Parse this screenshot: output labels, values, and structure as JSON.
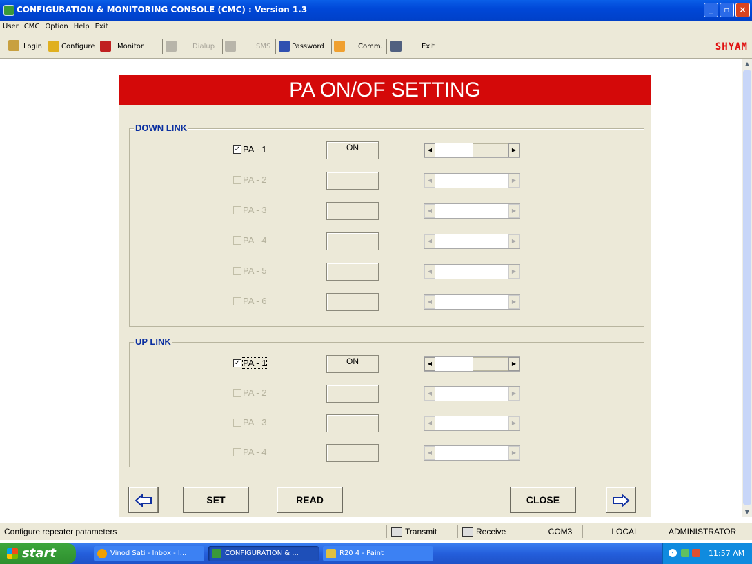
{
  "window": {
    "title": "CONFIGURATION & MONITORING CONSOLE (CMC) : Version 1.3",
    "brand": "SHYAM"
  },
  "menu": [
    "User",
    "CMC",
    "Option",
    "Help",
    "Exit"
  ],
  "toolbar": {
    "login": "Login",
    "configure": "Configure",
    "monitor": "Monitor",
    "dialup": "Dialup",
    "sms": "SMS",
    "password": "Password",
    "comm": "Comm.",
    "exit": "Exit"
  },
  "form": {
    "title": "PA ON/OF SETTING",
    "downlink": {
      "label": "DOWN LINK",
      "rows": [
        {
          "label": "PA - 1",
          "checked": true,
          "enabled": true,
          "status": "ON"
        },
        {
          "label": "PA - 2",
          "checked": false,
          "enabled": false,
          "status": ""
        },
        {
          "label": "PA - 3",
          "checked": false,
          "enabled": false,
          "status": ""
        },
        {
          "label": "PA - 4",
          "checked": false,
          "enabled": false,
          "status": ""
        },
        {
          "label": "PA - 5",
          "checked": false,
          "enabled": false,
          "status": ""
        },
        {
          "label": "PA - 6",
          "checked": false,
          "enabled": false,
          "status": ""
        }
      ]
    },
    "uplink": {
      "label": "UP LINK",
      "rows": [
        {
          "label": "PA - 1",
          "checked": true,
          "enabled": true,
          "status": "ON"
        },
        {
          "label": "PA - 2",
          "checked": false,
          "enabled": false,
          "status": ""
        },
        {
          "label": "PA - 3",
          "checked": false,
          "enabled": false,
          "status": ""
        },
        {
          "label": "PA - 4",
          "checked": false,
          "enabled": false,
          "status": ""
        }
      ]
    },
    "buttons": {
      "set": "SET",
      "read": "READ",
      "close": "CLOSE"
    }
  },
  "statusbar": {
    "message": "Configure repeater patameters",
    "transmit": "Transmit",
    "receive": "Receive",
    "port": "COM3",
    "mode": "LOCAL",
    "user": "ADMINISTRATOR"
  },
  "taskbar": {
    "start": "start",
    "tasks": [
      "Vinod Sati - Inbox - I...",
      "CONFIGURATION & ...",
      "R20 4 - Paint"
    ],
    "clock": "11:57 AM"
  },
  "colors": {
    "banner": "#d40909",
    "group_label": "#0a2fa0",
    "brand": "#e01010"
  }
}
